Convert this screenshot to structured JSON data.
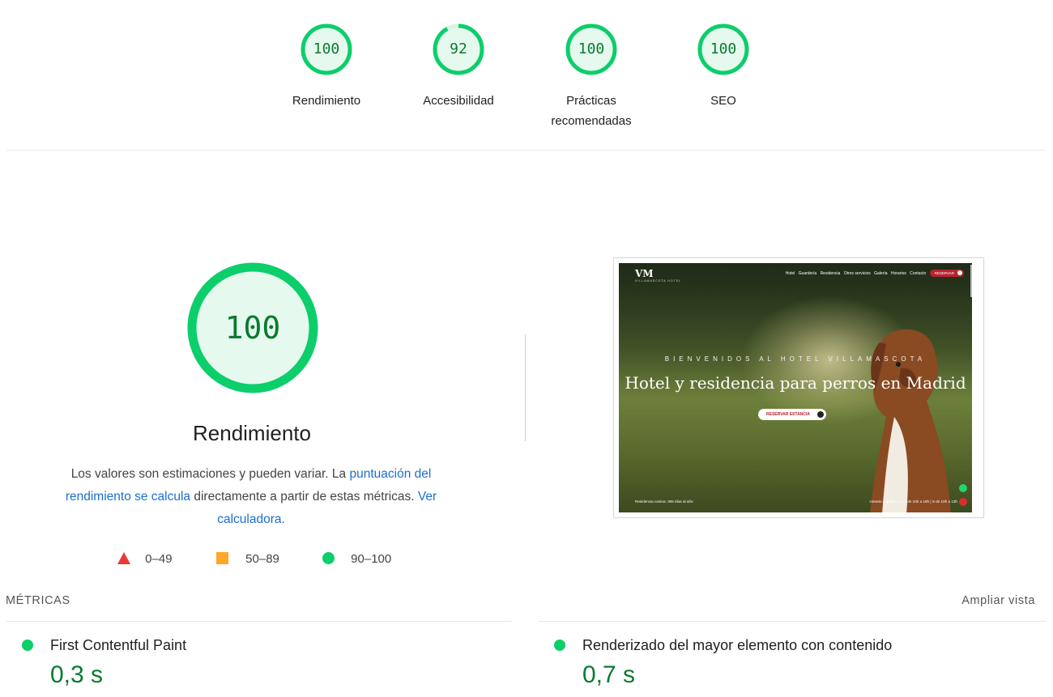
{
  "categories": [
    {
      "label": "Rendimiento",
      "score": 100,
      "fraction": 1.0
    },
    {
      "label": "Accesibilidad",
      "score": 92,
      "fraction": 0.92
    },
    {
      "label": "Prácticas recomendadas",
      "score": 100,
      "fraction": 1.0
    },
    {
      "label": "SEO",
      "score": 100,
      "fraction": 1.0
    }
  ],
  "performance": {
    "score": "100",
    "title": "Rendimiento",
    "desc_prefix": "Los valores son estimaciones y pueden variar. La ",
    "desc_link1": "puntuación del rendimiento se calcula",
    "desc_middle": " directamente a partir de estas métricas. ",
    "desc_link2": "Ver calculadora."
  },
  "legend": {
    "fail": "0–49",
    "average": "50–89",
    "pass": "90–100"
  },
  "thumbnail": {
    "logo": "VM",
    "logo_sub": "VILLAMASCOTA HOTEL",
    "nav": [
      "Hotel",
      "Guardería",
      "Residencia",
      "Otros servicios",
      "Galería",
      "Horarios",
      "Contacto"
    ],
    "reserve": "RESERVAR",
    "welcome": "BIENVENIDOS AL HOTEL VILLAMASCOTA",
    "headline": "Hotel y residencia para perros en Madrid",
    "cta": "RESERVAR ESTANCIA",
    "footer_left": "Residencia canina: 365 días al año",
    "footer_right": "Horario al público: L-V de 10h a 18h | S de 10h a 13h"
  },
  "metrics": {
    "title": "MÉTRICAS",
    "expand": "Ampliar vista",
    "items": [
      {
        "label": "First Contentful Paint",
        "value": "0,3 s"
      },
      {
        "label": "Renderizado del mayor elemento con contenido",
        "value": "0,7 s"
      }
    ]
  },
  "colors": {
    "pass": "#0cce6b",
    "pass_text": "#0a7a2f",
    "average": "#ffa727",
    "fail": "#eb3a34",
    "link": "#1a6fd1"
  }
}
